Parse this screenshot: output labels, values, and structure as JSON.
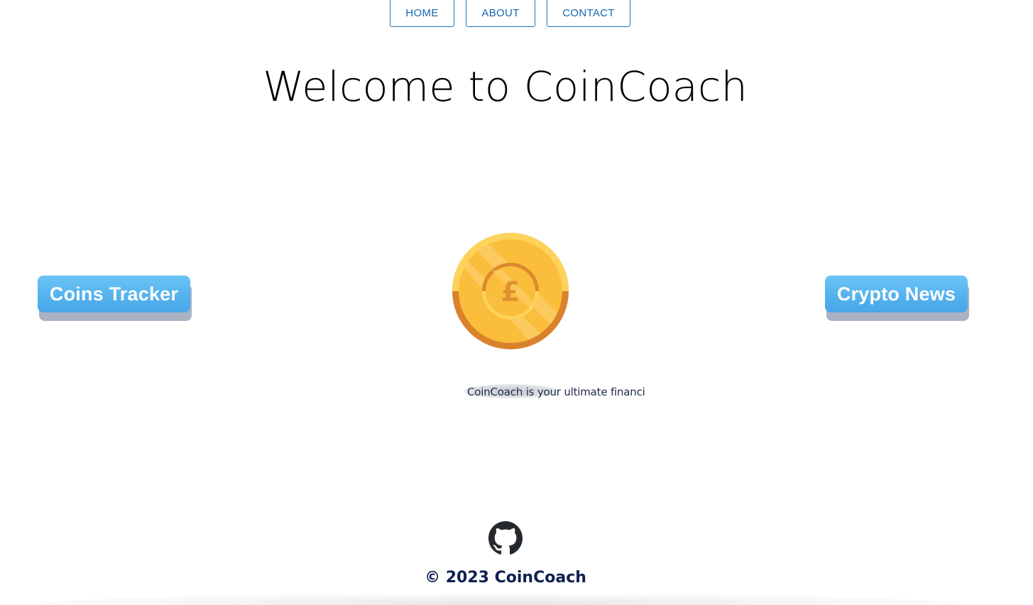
{
  "nav": {
    "items": [
      {
        "label": "HOME"
      },
      {
        "label": "ABOUT"
      },
      {
        "label": "CONTACT"
      }
    ]
  },
  "main": {
    "title": "Welcome to CoinCoach",
    "left_button": "Coins Tracker",
    "right_button": "Crypto News",
    "coin_symbol": "£",
    "tagline": "CoinCoach is your ultimate financi"
  },
  "footer": {
    "icon": "github-icon",
    "copyright": "© 2023 CoinCoach"
  },
  "colors": {
    "nav_accent": "#1467b0",
    "button_blue": "#54b2ee",
    "coin_gold": "#fbbd3c",
    "coin_rim": "#d98a2e",
    "footer_text": "#0f1f4f"
  }
}
